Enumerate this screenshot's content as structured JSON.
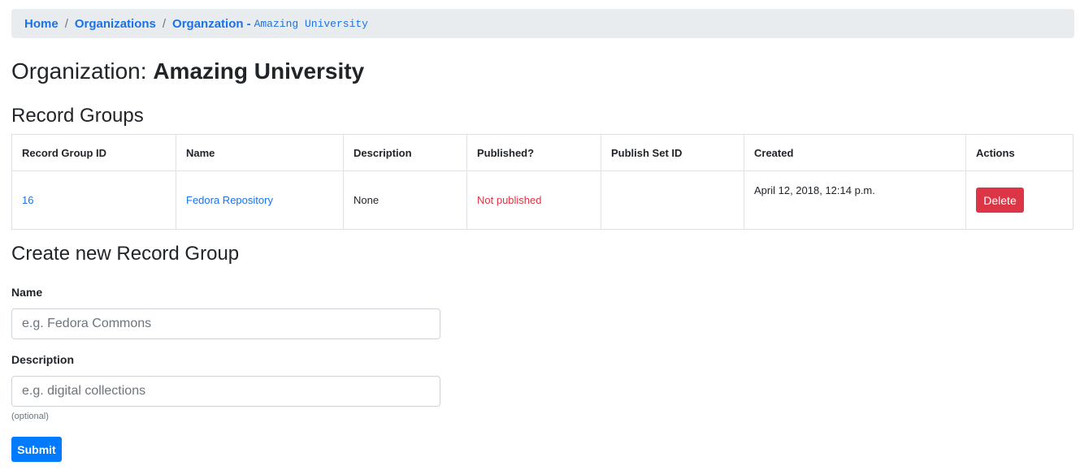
{
  "breadcrumb": {
    "home": "Home",
    "separator": "/",
    "organizations": "Organizations",
    "organization": "Organzation",
    "dash": "-",
    "org_name": "Amazing University"
  },
  "page": {
    "title_prefix": "Organization:",
    "title_name": "Amazing University"
  },
  "record_groups": {
    "heading": "Record Groups",
    "columns": [
      "Record Group ID",
      "Name",
      "Description",
      "Published?",
      "Publish Set ID",
      "Created",
      "Actions"
    ],
    "rows": [
      {
        "id": "16",
        "name": "Fedora Repository",
        "description": "None",
        "published": "Not published",
        "publish_set_id": "",
        "created": "April 12, 2018, 12:14 p.m.",
        "action_label": "Delete"
      }
    ]
  },
  "create_form": {
    "heading": "Create new Record Group",
    "name_label": "Name",
    "name_placeholder": "e.g. Fedora Commons",
    "description_label": "Description",
    "description_placeholder": "e.g. digital collections",
    "description_help": "(optional)",
    "submit_label": "Submit"
  },
  "colors": {
    "link": "#1a73e8",
    "danger": "#dc3545",
    "primary": "#007bff",
    "breadcrumb_bg": "#e9ecef"
  }
}
